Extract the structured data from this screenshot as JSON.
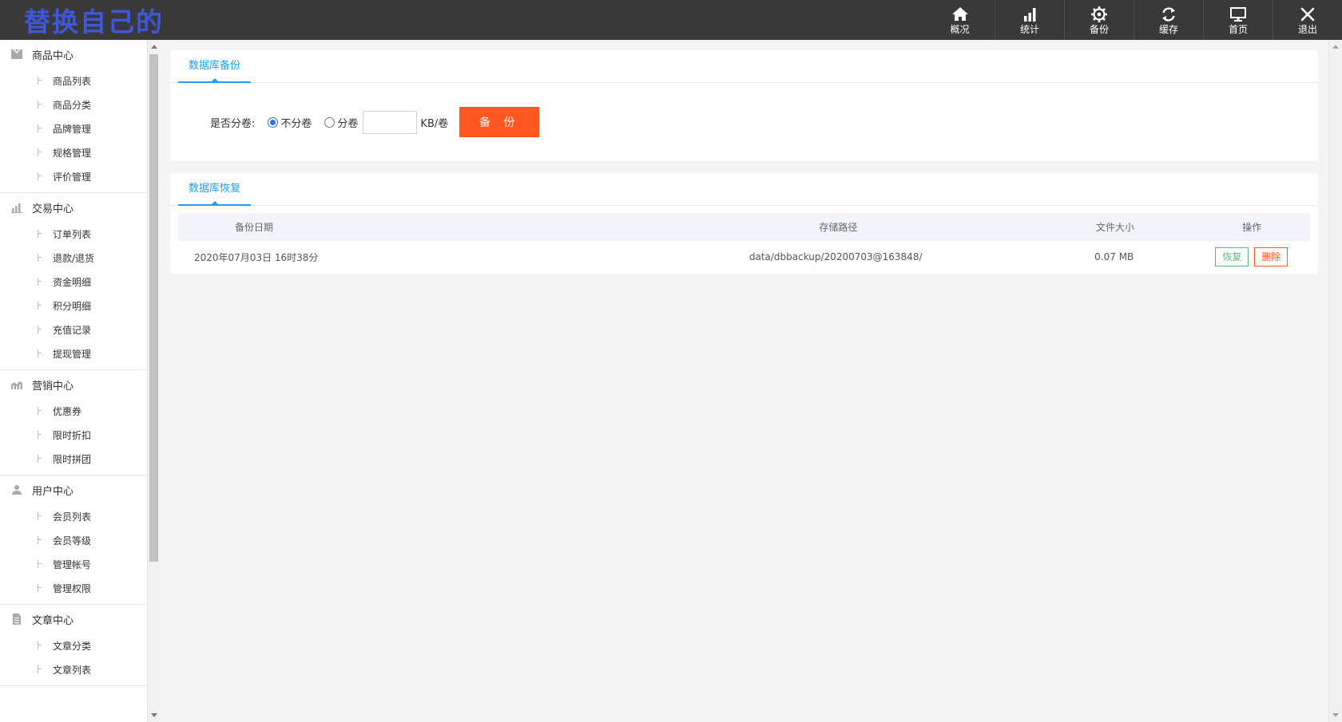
{
  "app": {
    "logo_text": "替换自己的"
  },
  "topnav": [
    {
      "icon": "home-icon",
      "label": "概况"
    },
    {
      "icon": "bar-chart-icon",
      "label": "统计"
    },
    {
      "icon": "gear-icon",
      "label": "备份"
    },
    {
      "icon": "refresh-icon",
      "label": "缓存"
    },
    {
      "icon": "monitor-icon",
      "label": "首页"
    },
    {
      "icon": "close-icon",
      "label": "退出"
    }
  ],
  "sidebar": {
    "groups": [
      {
        "icon": "box-icon",
        "title": "商品中心",
        "items": [
          "商品列表",
          "商品分类",
          "品牌管理",
          "规格管理",
          "评价管理"
        ]
      },
      {
        "icon": "bar-chart-icon",
        "title": "交易中心",
        "items": [
          "订单列表",
          "退款/退货",
          "资金明细",
          "积分明细",
          "充值记录",
          "提现管理"
        ]
      },
      {
        "icon": "area-chart-icon",
        "title": "营销中心",
        "items": [
          "优惠券",
          "限时折扣",
          "限时拼团"
        ]
      },
      {
        "icon": "user-icon",
        "title": "用户中心",
        "items": [
          "会员列表",
          "会员等级",
          "管理帐号",
          "管理权限"
        ]
      },
      {
        "icon": "document-icon",
        "title": "文章中心",
        "items": [
          "文章分类",
          "文章列表"
        ]
      }
    ]
  },
  "backup_panel": {
    "tab": "数据库备份",
    "split_label": "是否分卷:",
    "options": [
      {
        "label": "不分卷",
        "checked": true
      },
      {
        "label": "分卷",
        "checked": false
      }
    ],
    "size_value": "",
    "size_unit": "KB/卷",
    "button_label": "备 份"
  },
  "restore_panel": {
    "tab": "数据库恢复",
    "columns": [
      "备份日期",
      "存储路径",
      "文件大小",
      "操作"
    ],
    "rows": [
      {
        "date": "2020年07月03日 16时38分",
        "path": "data/dbbackup/20200703@163848/",
        "size": "0.07 MB",
        "actions": [
          "恢复",
          "删除"
        ]
      }
    ]
  }
}
